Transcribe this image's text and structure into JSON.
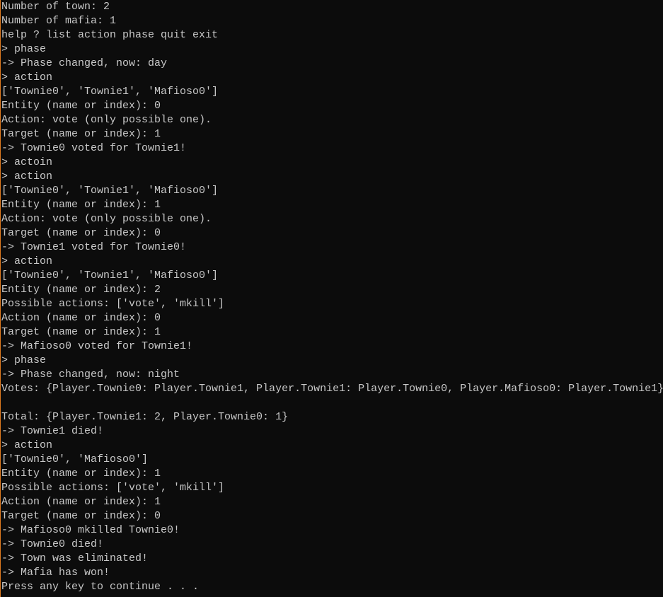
{
  "console": {
    "text_color": "#c8c8c8",
    "background": "#0c0c0c",
    "lines": [
      "Number of town: 2",
      "Number of mafia: 1",
      "help ? list action phase quit exit",
      "> phase",
      "-> Phase changed, now: day",
      "> action",
      "['Townie0', 'Townie1', 'Mafioso0']",
      "Entity (name or index): 0",
      "Action: vote (only possible one).",
      "Target (name or index): 1",
      "-> Townie0 voted for Townie1!",
      "> actoin",
      "> action",
      "['Townie0', 'Townie1', 'Mafioso0']",
      "Entity (name or index): 1",
      "Action: vote (only possible one).",
      "Target (name or index): 0",
      "-> Townie1 voted for Townie0!",
      "> action",
      "['Townie0', 'Townie1', 'Mafioso0']",
      "Entity (name or index): 2",
      "Possible actions: ['vote', 'mkill']",
      "Action (name or index): 0",
      "Target (name or index): 1",
      "-> Mafioso0 voted for Townie1!",
      "> phase",
      "-> Phase changed, now: night",
      "Votes: {Player.Townie0: Player.Townie1, Player.Townie1: Player.Townie0, Player.Mafioso0: Player.Townie1}",
      "",
      "Total: {Player.Townie1: 2, Player.Townie0: 1}",
      "-> Townie1 died!",
      "> action",
      "['Townie0', 'Mafioso0']",
      "Entity (name or index): 1",
      "Possible actions: ['vote', 'mkill']",
      "Action (name or index): 1",
      "Target (name or index): 0",
      "-> Mafioso0 mkilled Townie0!",
      "-> Townie0 died!",
      "-> Town was eliminated!",
      "-> Mafia has won!",
      "Press any key to continue . . ."
    ]
  }
}
